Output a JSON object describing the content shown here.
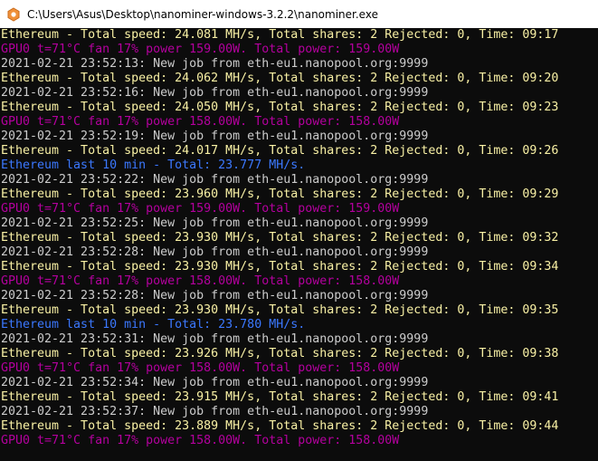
{
  "window": {
    "title": "C:\\Users\\Asus\\Desktop\\nanominer-windows-3.2.2\\nanominer.exe",
    "icon": "nanominer-app-icon"
  },
  "colors": {
    "yellow": "#f9f1a5",
    "white": "#cccccc",
    "magenta": "#b4009e",
    "blue": "#3b78ff"
  },
  "console": {
    "lines": [
      {
        "color": "yellow",
        "text": "Ethereum - Total speed: 24.081 MH/s, Total shares: 2 Rejected: 0, Time: 09:17"
      },
      {
        "color": "magenta",
        "text": "GPU0 t=71°C fan 17% power 159.00W. Total power: 159.00W"
      },
      {
        "color": "white",
        "text": "2021-02-21 23:52:13: New job from eth-eu1.nanopool.org:9999"
      },
      {
        "color": "yellow",
        "text": "Ethereum - Total speed: 24.062 MH/s, Total shares: 2 Rejected: 0, Time: 09:20"
      },
      {
        "color": "white",
        "text": "2021-02-21 23:52:16: New job from eth-eu1.nanopool.org:9999"
      },
      {
        "color": "yellow",
        "text": "Ethereum - Total speed: 24.050 MH/s, Total shares: 2 Rejected: 0, Time: 09:23"
      },
      {
        "color": "magenta",
        "text": "GPU0 t=71°C fan 17% power 158.00W. Total power: 158.00W"
      },
      {
        "color": "white",
        "text": "2021-02-21 23:52:19: New job from eth-eu1.nanopool.org:9999"
      },
      {
        "color": "yellow",
        "text": "Ethereum - Total speed: 24.017 MH/s, Total shares: 2 Rejected: 0, Time: 09:26"
      },
      {
        "color": "blue",
        "text": "Ethereum last 10 min - Total: 23.777 MH/s."
      },
      {
        "color": "white",
        "text": "2021-02-21 23:52:22: New job from eth-eu1.nanopool.org:9999"
      },
      {
        "color": "yellow",
        "text": "Ethereum - Total speed: 23.960 MH/s, Total shares: 2 Rejected: 0, Time: 09:29"
      },
      {
        "color": "magenta",
        "text": "GPU0 t=71°C fan 17% power 159.00W. Total power: 159.00W"
      },
      {
        "color": "white",
        "text": "2021-02-21 23:52:25: New job from eth-eu1.nanopool.org:9999"
      },
      {
        "color": "yellow",
        "text": "Ethereum - Total speed: 23.930 MH/s, Total shares: 2 Rejected: 0, Time: 09:32"
      },
      {
        "color": "white",
        "text": "2021-02-21 23:52:28: New job from eth-eu1.nanopool.org:9999"
      },
      {
        "color": "yellow",
        "text": "Ethereum - Total speed: 23.930 MH/s, Total shares: 2 Rejected: 0, Time: 09:34"
      },
      {
        "color": "magenta",
        "text": "GPU0 t=71°C fan 17% power 158.00W. Total power: 158.00W"
      },
      {
        "color": "white",
        "text": "2021-02-21 23:52:28: New job from eth-eu1.nanopool.org:9999"
      },
      {
        "color": "yellow",
        "text": "Ethereum - Total speed: 23.930 MH/s, Total shares: 2 Rejected: 0, Time: 09:35"
      },
      {
        "color": "blue",
        "text": "Ethereum last 10 min - Total: 23.780 MH/s."
      },
      {
        "color": "white",
        "text": "2021-02-21 23:52:31: New job from eth-eu1.nanopool.org:9999"
      },
      {
        "color": "yellow",
        "text": "Ethereum - Total speed: 23.926 MH/s, Total shares: 2 Rejected: 0, Time: 09:38"
      },
      {
        "color": "magenta",
        "text": "GPU0 t=71°C fan 17% power 158.00W. Total power: 158.00W"
      },
      {
        "color": "white",
        "text": "2021-02-21 23:52:34: New job from eth-eu1.nanopool.org:9999"
      },
      {
        "color": "yellow",
        "text": "Ethereum - Total speed: 23.915 MH/s, Total shares: 2 Rejected: 0, Time: 09:41"
      },
      {
        "color": "white",
        "text": "2021-02-21 23:52:37: New job from eth-eu1.nanopool.org:9999"
      },
      {
        "color": "yellow",
        "text": "Ethereum - Total speed: 23.889 MH/s, Total shares: 2 Rejected: 0, Time: 09:44"
      },
      {
        "color": "magenta",
        "text": "GPU0 t=71°C fan 17% power 158.00W. Total power: 158.00W"
      }
    ]
  }
}
